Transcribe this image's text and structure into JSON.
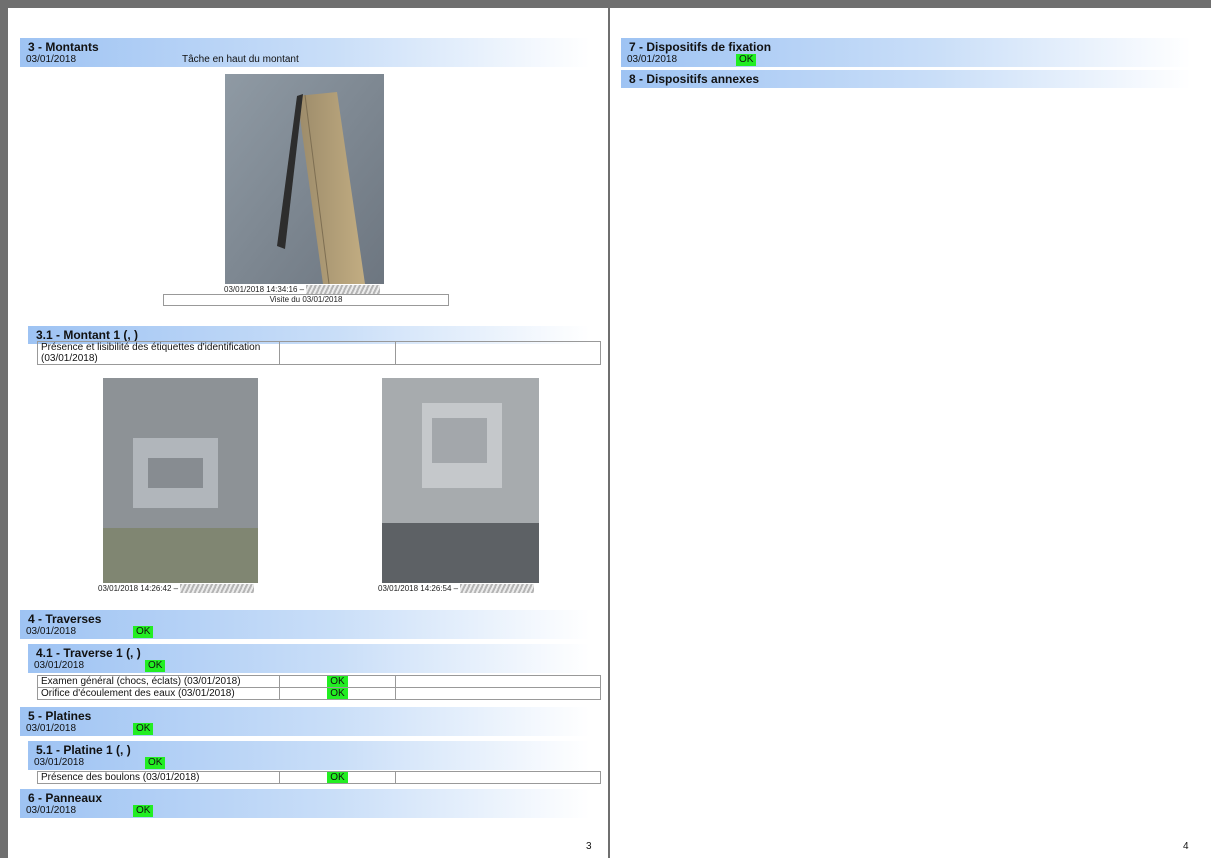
{
  "left_page": {
    "page_number": "3",
    "section3": {
      "title": "3 - Montants",
      "date": "03/01/2018",
      "note": "Tâche en haut du montant"
    },
    "photo_main": {
      "caption": "03/01/2018 14:34:16 –",
      "visit": "Visite du 03/01/2018"
    },
    "section31": {
      "title": "3.1 - Montant 1 (, )",
      "row_label": "Présence et lisibilité des étiquettes d'identification (03/01/2018)"
    },
    "photo_a": {
      "caption": "03/01/2018 14:26:42 –"
    },
    "photo_b": {
      "caption": "03/01/2018 14:26:54 –"
    },
    "section4": {
      "title": "4 - Traverses",
      "date": "03/01/2018",
      "status": "OK"
    },
    "section41": {
      "title": "4.1 - Traverse 1 (, )",
      "date": "03/01/2018",
      "status": "OK",
      "rows": [
        {
          "label": "Examen général (chocs, éclats) (03/01/2018)",
          "status": "OK"
        },
        {
          "label": "Orifice d'écoulement des eaux (03/01/2018)",
          "status": "OK"
        }
      ]
    },
    "section5": {
      "title": "5 - Platines",
      "date": "03/01/2018",
      "status": "OK"
    },
    "section51": {
      "title": "5.1 - Platine 1 (, )",
      "date": "03/01/2018",
      "status": "OK",
      "rows": [
        {
          "label": "Présence des boulons (03/01/2018)",
          "status": "OK"
        }
      ]
    },
    "section6": {
      "title": "6 - Panneaux",
      "date": "03/01/2018",
      "status": "OK"
    }
  },
  "right_page": {
    "page_number": "4",
    "section7": {
      "title": "7 - Dispositifs de fixation",
      "date": "03/01/2018",
      "status": "OK"
    },
    "section8": {
      "title": "8 - Dispositifs annexes"
    }
  },
  "colors": {
    "header_blue": "#9ec3f3",
    "ok_green": "#22ee22",
    "viewer_bg": "#6f6f6f"
  },
  "icons": {
    "redaction": "redacted-author-stamp"
  }
}
